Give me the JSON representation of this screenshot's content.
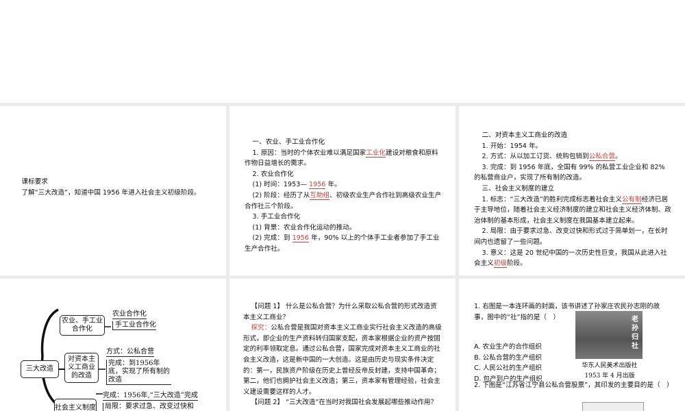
{
  "slides": {
    "s1": {
      "heading": "课标要求",
      "text": "了解“三大改造”，知道中国 1956 年进入社会主义初级阶段。"
    },
    "s2": {
      "lines": [
        "一、农业、手工业合作化",
        "1. 原因：当时的个体农业难以满足国家工业化建设对粮食和原料作物日益增长的需求。",
        "2. 农业合作化",
        "(1) 时间：1953— 1956 年。",
        "(2) 阶段：经历了从互助组、初级农业生产合作社到高级农业生产合作社三个阶段。",
        "3. 手工业合作化",
        "(1) 背景：农业合作化运动的推动。",
        "(2) 完成：到 1956 年，90% 以上的个体手工业者参加了手工业生产合作社。"
      ],
      "blanks": [
        "工业化",
        "1956",
        "互助组",
        "手工业生产合作社"
      ]
    },
    "s3": {
      "lines": [
        "二、对资本主义工商业的改造",
        "1. 开始：1954 年。",
        "2. 方式：从以加工订货、统购包销到公私合营。",
        "3. 完成：到 1956 年底，全国有 99% 的私营工业企业和 82% 的私营商业户，实现了所有制的改造。",
        "三、社会主义制度的建立",
        "1. 标志：“三大改造”的胜利完成标志着社会主义公有制经济已居于主导地位，随着社会主义经济制度的建立和社会主义经济体制、政治体制的基本形成，社会主义制度在我国基本建立起来。",
        "2. 局限：由于要求过急、改变过快和形式过于简单划一，在长时间内也遗留了一些问题。",
        "3. 意义：这是 20 世纪中国的一次历史性巨变，我国从此进入社会主义初级阶段。"
      ],
      "blanks": [
        "公私合营",
        "公有制",
        "初级"
      ]
    },
    "s4": {
      "root": "三大改造",
      "branches": [
        {
          "label": "农业、手工业合作化",
          "leaves": [
            "农业合作化",
            "手工业合作化"
          ]
        },
        {
          "label": "对资本主义工商业的改造",
          "leaves": [
            "方式：公私合营",
            "完成：到1956年底，实现了所有制的改造"
          ]
        },
        {
          "label": "社会主义制度的建立",
          "leaves": [
            "完成：1956年,“三大改造”完成",
            "局限：要求过急、改变过快和"
          ]
        }
      ]
    },
    "s5": {
      "q1": "【问题 1】 什么是公私合营？为什么采取公私合营的形式改造资本主义工商业？",
      "explore_label": "探究：",
      "explore": "公私合营是我国对资本主义工商业实行社会主义改造的高级形式，即企业的生产资料转归国家支配，资本家根据企业的资产按固定的利率领取定息。通过公私合营，国家完成对资本主义工商业的社会主义改造，这是新中国的一大创造。这是由历史与现实条件决定的：第一，民族资产阶级在历史上曾经反帝反封建，支持中国革命；第二，他们也拥护社会主义改造；第三，资本家有管理经验，社会主义建设需要这样的人才。",
      "q2": "【问题 2】 “三大改造”在当时对我国社会发展起哪些推动作用？"
    },
    "s6": {
      "q1": "1. 右图是一本连环画的封面，该书讲述了孙家庄农民孙志刚的故事，图中的“社”指的是（　）",
      "options": [
        "A. 农业生产的合作组织",
        "B. 公私合营的生产组织",
        "C. 人民公社的生产组织",
        "D. 包产到户的生产组织"
      ],
      "cover_title": "老孙归社",
      "caption1": "华东人民美术出版社",
      "caption2": "1953 年 4 月出版",
      "q2": "2. 下图是“江苏省江宁县公私合营股票”，其印发的主要目的是（　）"
    }
  }
}
